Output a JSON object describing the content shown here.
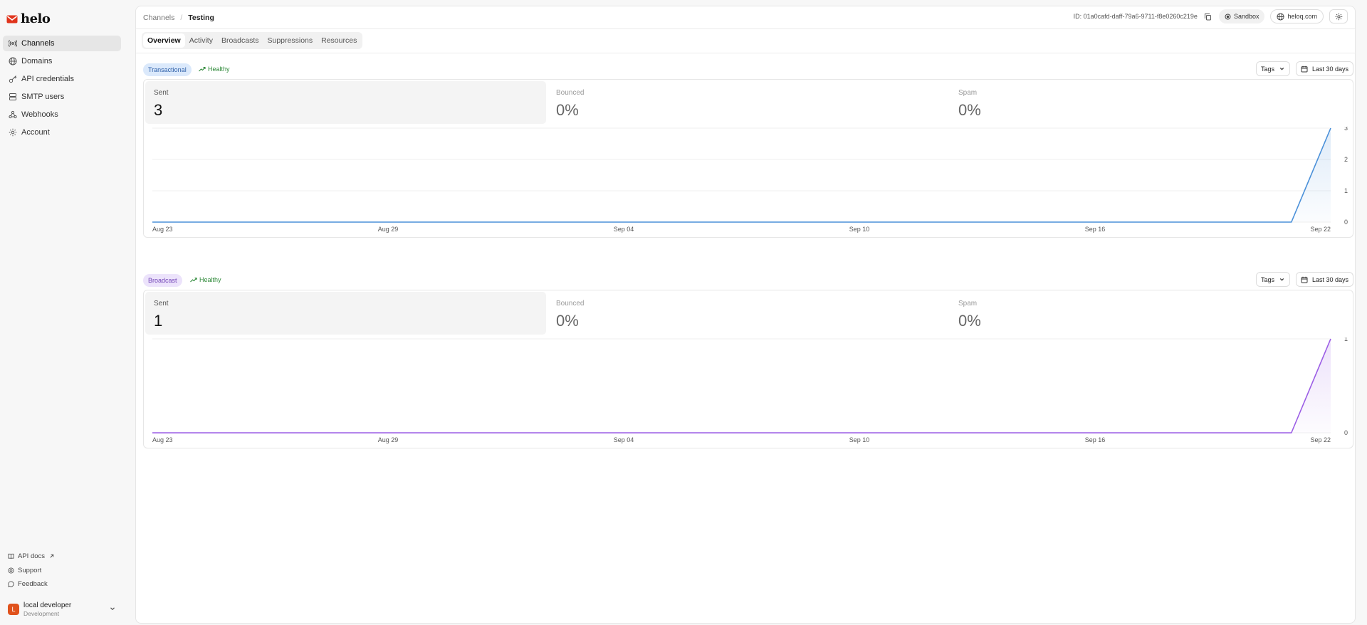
{
  "app": {
    "name": "helo"
  },
  "sidebar": {
    "items": [
      {
        "label": "Channels",
        "icon": "radio-icon"
      },
      {
        "label": "Domains",
        "icon": "globe-icon"
      },
      {
        "label": "API credentials",
        "icon": "key-icon"
      },
      {
        "label": "SMTP users",
        "icon": "server-icon"
      },
      {
        "label": "Webhooks",
        "icon": "webhook-icon"
      },
      {
        "label": "Account",
        "icon": "gear-icon"
      }
    ],
    "footer_links": [
      {
        "label": "API docs",
        "icon": "book-icon"
      },
      {
        "label": "Support",
        "icon": "help-icon"
      },
      {
        "label": "Feedback",
        "icon": "message-icon"
      }
    ],
    "user": {
      "initial": "L",
      "name": "local developer",
      "environment": "Development"
    }
  },
  "header": {
    "breadcrumb_parent": "Channels",
    "breadcrumb_separator": "/",
    "breadcrumb_current": "Testing",
    "channel_id": "ID: 01a0cafd-daff-79a6-9711-f8e0260c219e",
    "sandbox_label": "Sandbox",
    "domain_label": "heloq.com"
  },
  "tabs": [
    "Overview",
    "Activity",
    "Broadcasts",
    "Suppressions",
    "Resources"
  ],
  "colors": {
    "transactional_line": "#4a90d9",
    "broadcast_line": "#9b5de5",
    "healthy": "#2f8a3a",
    "avatar": "#e0521c"
  },
  "sections": [
    {
      "type_label": "Transactional",
      "health": "Healthy",
      "tags_label": "Tags",
      "range_label": "Last 30 days",
      "stats": [
        {
          "label": "Sent",
          "value": "3"
        },
        {
          "label": "Bounced",
          "value": "0%"
        },
        {
          "label": "Spam",
          "value": "0%"
        }
      ]
    },
    {
      "type_label": "Broadcast",
      "health": "Healthy",
      "tags_label": "Tags",
      "range_label": "Last 30 days",
      "stats": [
        {
          "label": "Sent",
          "value": "1"
        },
        {
          "label": "Bounced",
          "value": "0%"
        },
        {
          "label": "Spam",
          "value": "0%"
        }
      ]
    }
  ],
  "chart_data": [
    {
      "type": "area",
      "x": [
        "Aug 23",
        "Aug 24",
        "Aug 25",
        "Aug 26",
        "Aug 27",
        "Aug 28",
        "Aug 29",
        "Aug 30",
        "Aug 31",
        "Sep 01",
        "Sep 02",
        "Sep 03",
        "Sep 04",
        "Sep 05",
        "Sep 06",
        "Sep 07",
        "Sep 08",
        "Sep 09",
        "Sep 10",
        "Sep 11",
        "Sep 12",
        "Sep 13",
        "Sep 14",
        "Sep 15",
        "Sep 16",
        "Sep 17",
        "Sep 18",
        "Sep 19",
        "Sep 20",
        "Sep 21",
        "Sep 22"
      ],
      "x_ticks": [
        "Aug 23",
        "Aug 29",
        "Sep 04",
        "Sep 10",
        "Sep 16",
        "Sep 22"
      ],
      "y_ticks": [
        0,
        1,
        2,
        3
      ],
      "ylim": [
        0,
        3
      ],
      "series": [
        {
          "values": [
            0,
            0,
            0,
            0,
            0,
            0,
            0,
            0,
            0,
            0,
            0,
            0,
            0,
            0,
            0,
            0,
            0,
            0,
            0,
            0,
            0,
            0,
            0,
            0,
            0,
            0,
            0,
            0,
            0,
            0,
            3
          ]
        }
      ],
      "grid": true
    },
    {
      "type": "area",
      "x": [
        "Aug 23",
        "Aug 24",
        "Aug 25",
        "Aug 26",
        "Aug 27",
        "Aug 28",
        "Aug 29",
        "Aug 30",
        "Aug 31",
        "Sep 01",
        "Sep 02",
        "Sep 03",
        "Sep 04",
        "Sep 05",
        "Sep 06",
        "Sep 07",
        "Sep 08",
        "Sep 09",
        "Sep 10",
        "Sep 11",
        "Sep 12",
        "Sep 13",
        "Sep 14",
        "Sep 15",
        "Sep 16",
        "Sep 17",
        "Sep 18",
        "Sep 19",
        "Sep 20",
        "Sep 21",
        "Sep 22"
      ],
      "x_ticks": [
        "Aug 23",
        "Aug 29",
        "Sep 04",
        "Sep 10",
        "Sep 16",
        "Sep 22"
      ],
      "y_ticks": [
        0,
        1
      ],
      "ylim": [
        0,
        1
      ],
      "series": [
        {
          "values": [
            0,
            0,
            0,
            0,
            0,
            0,
            0,
            0,
            0,
            0,
            0,
            0,
            0,
            0,
            0,
            0,
            0,
            0,
            0,
            0,
            0,
            0,
            0,
            0,
            0,
            0,
            0,
            0,
            0,
            0,
            1
          ]
        }
      ],
      "grid": true
    }
  ]
}
